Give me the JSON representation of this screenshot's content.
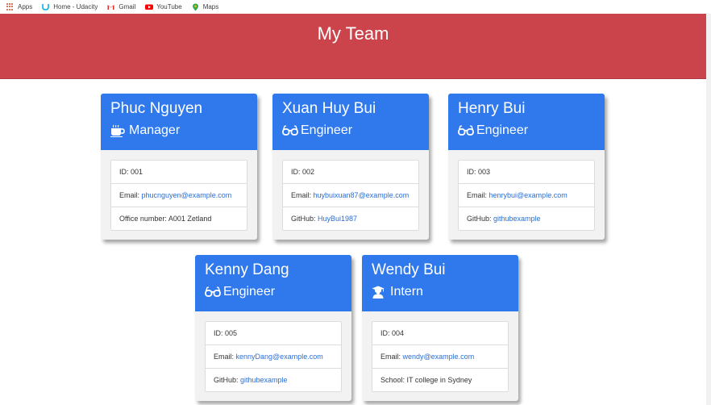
{
  "bookmarks": [
    {
      "label": "Apps",
      "icon": "apps-icon"
    },
    {
      "label": "Home - Udacity",
      "icon": "udacity-icon"
    },
    {
      "label": "Gmail",
      "icon": "gmail-icon"
    },
    {
      "label": "YouTube",
      "icon": "youtube-icon"
    },
    {
      "label": "Maps",
      "icon": "maps-icon"
    }
  ],
  "header": {
    "title": "My Team",
    "color": "#cc444b"
  },
  "accent": "#3079ed",
  "cards": [
    {
      "name": "Phuc Nguyen",
      "role": "Manager",
      "role_icon": "coffee-icon",
      "rows": [
        {
          "label": "ID: ",
          "value": "001",
          "link": false
        },
        {
          "label": "Email: ",
          "value": "phucnguyen@example.com",
          "link": true
        },
        {
          "label": "Office number: ",
          "value": "A001 Zetland",
          "link": false
        }
      ]
    },
    {
      "name": "Xuan Huy Bui",
      "role": "Engineer",
      "role_icon": "glasses-icon",
      "rows": [
        {
          "label": "ID: ",
          "value": "002",
          "link": false
        },
        {
          "label": "Email: ",
          "value": "huybuixuan87@example.com",
          "link": true
        },
        {
          "label": "GitHub: ",
          "value": "HuyBui1987",
          "link": true
        }
      ]
    },
    {
      "name": "Henry Bui",
      "role": "Engineer",
      "role_icon": "glasses-icon",
      "rows": [
        {
          "label": "ID: ",
          "value": "003",
          "link": false
        },
        {
          "label": "Email: ",
          "value": "henrybui@example.com",
          "link": true
        },
        {
          "label": "GitHub: ",
          "value": "githubexample",
          "link": true
        }
      ]
    },
    {
      "name": "Kenny Dang",
      "role": "Engineer",
      "role_icon": "glasses-icon",
      "rows": [
        {
          "label": "ID: ",
          "value": "005",
          "link": false
        },
        {
          "label": "Email: ",
          "value": "kennyDang@example.com",
          "link": true
        },
        {
          "label": "GitHub: ",
          "value": "githubexample",
          "link": true
        }
      ]
    },
    {
      "name": "Wendy Bui",
      "role": "Intern",
      "role_icon": "graduate-icon",
      "rows": [
        {
          "label": "ID: ",
          "value": "004",
          "link": false
        },
        {
          "label": "Email: ",
          "value": "wendy@example.com",
          "link": true
        },
        {
          "label": "School: ",
          "value": "IT college in Sydney",
          "link": false
        }
      ]
    }
  ]
}
